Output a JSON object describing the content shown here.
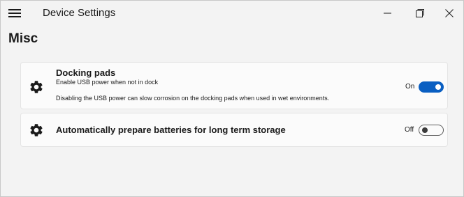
{
  "window": {
    "title": "Device Settings",
    "controls": [
      "minimize",
      "maximize",
      "close"
    ]
  },
  "section": {
    "title": "Misc"
  },
  "settings": [
    {
      "icon": "gear-icon",
      "title": "Docking pads",
      "subtitle": "Enable USB power when not in dock",
      "description": "Disabling the USB power can slow corrosion on the docking pads when used in wet environments.",
      "toggle_label": "On",
      "enabled": true
    },
    {
      "icon": "gear-icon",
      "title": "Automatically prepare batteries for long term storage",
      "toggle_label": "Off",
      "enabled": false
    }
  ],
  "colors": {
    "accent": "#0a5fc2",
    "background": "#f3f3f3",
    "card": "#fbfbfb"
  }
}
